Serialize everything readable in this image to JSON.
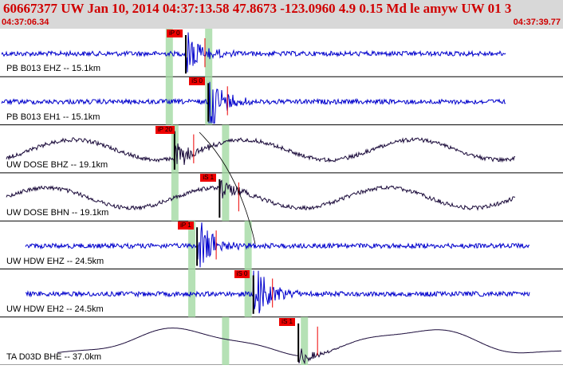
{
  "header": {
    "title": "60667377 UW Jan 10, 2014 04:37:13.58   47.8673 -123.0960  4.9 0.15 Md le amyw UW 01   3",
    "start_time": "04:37:06.34",
    "end_time": "04:37:39.77"
  },
  "colors": {
    "header_background": "#d8d8d8",
    "title_text": "#d00000",
    "trace_short_period": "#0000cc",
    "trace_broadband": "#1a0a3a",
    "pick_flag": "#ee0000",
    "pick_window": "#a8dca8"
  },
  "channels": [
    {
      "label": "PB B013 EHZ -- 15.1km",
      "pick": "iP 0",
      "kind": "sp",
      "amp": 0.25,
      "onset": 0.33,
      "burst": 3.2,
      "windows": [
        0.3,
        0.37
      ]
    },
    {
      "label": "PB B013 EH1 -- 15.1km",
      "pick": "iS 0",
      "kind": "sp",
      "amp": 0.05,
      "onset": 0.37,
      "burst": 4.0,
      "windows": [
        0.3,
        0.37
      ]
    },
    {
      "label": "UW DOSE BHZ -- 19.1km",
      "pick": "iP 20",
      "kind": "bb",
      "amp": 0.35,
      "onset": 0.31,
      "burst": 1.8,
      "windows": [
        0.31,
        0.4
      ]
    },
    {
      "label": "UW DOSE BHN -- 19.1km",
      "pick": "iS 1",
      "kind": "bb",
      "amp": 0.35,
      "onset": 0.39,
      "burst": 1.5,
      "windows": [
        0.31,
        0.4
      ]
    },
    {
      "label": "UW HDW EHZ -- 24.5km",
      "pick": "iP 1",
      "kind": "sp",
      "amp": 0.08,
      "onset": 0.35,
      "burst": 4.0,
      "windows": [
        0.34,
        0.44
      ]
    },
    {
      "label": "UW HDW EH2 -- 24.5km",
      "pick": "iS 0",
      "kind": "sp",
      "amp": 0.08,
      "onset": 0.45,
      "burst": 4.0,
      "windows": [
        0.34,
        0.44
      ]
    },
    {
      "label": "TA D03D BHE -- 37.0km",
      "pick": "iS 1",
      "kind": "lp",
      "amp": 0.45,
      "onset": 0.53,
      "burst": 1.2,
      "windows": [
        0.4,
        0.54
      ]
    }
  ]
}
